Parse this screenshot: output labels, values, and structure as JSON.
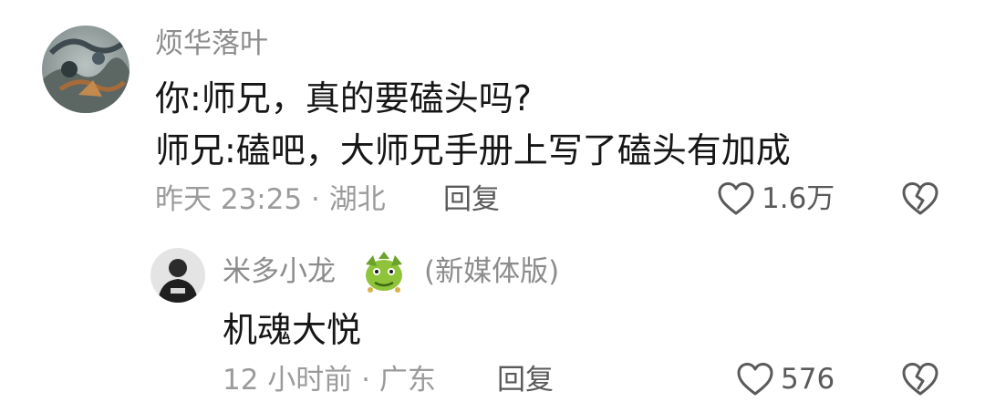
{
  "comment": {
    "username": "烦华落叶",
    "lines": [
      "你:师兄，真的要磕头吗?",
      "师兄:磕吧，大师兄手册上写了磕头有加成"
    ],
    "meta": "昨天 23:25 · 湖北",
    "reply_label": "回复",
    "like_count": "1.6万",
    "avatar_icon": "landscape-painting-avatar",
    "like_icon": "heart-outline-icon",
    "dislike_icon": "broken-heart-icon"
  },
  "reply": {
    "username": "米多小龙",
    "badge_icon": "green-dragon-badge-icon",
    "tag": "(新媒体版)",
    "text": "机魂大悦",
    "meta": "12 小时前 · 广东",
    "reply_label": "回复",
    "like_count": "576",
    "avatar_icon": "person-portrait-avatar",
    "like_icon": "heart-outline-icon",
    "dislike_icon": "broken-heart-icon"
  },
  "colors": {
    "username": "#8c8c8c",
    "text": "#161616",
    "meta": "#9b9b9b",
    "action": "#5a5a5a"
  }
}
